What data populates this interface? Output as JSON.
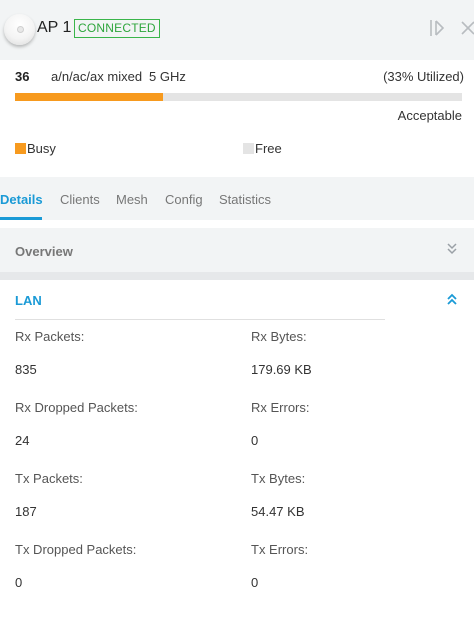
{
  "header": {
    "ap_name": "AP 1",
    "status": "CONNECTED",
    "status_color": "#2ea53c"
  },
  "radio": {
    "channel": "36",
    "mode": "a/n/ac/ax mixed",
    "band": "5 GHz",
    "utilization_text": "(33% Utilized)",
    "utilization_fraction": 0.33,
    "quality": "Acceptable",
    "busy_color": "#f79a1e",
    "free_color": "#e4e4e4"
  },
  "legend": {
    "busy_label": "Busy",
    "free_label": "Free"
  },
  "tabs": [
    {
      "label": "Details",
      "active": true
    },
    {
      "label": "Clients",
      "active": false
    },
    {
      "label": "Mesh",
      "active": false
    },
    {
      "label": "Config",
      "active": false
    },
    {
      "label": "Statistics",
      "active": false
    }
  ],
  "sections": {
    "overview_title": "Overview",
    "lan_title": "LAN"
  },
  "lan": {
    "rx_packets_label": "Rx Packets:",
    "rx_packets": "835",
    "rx_bytes_label": "Rx Bytes:",
    "rx_bytes": "179.69 KB",
    "rx_dropped_label": "Rx Dropped Packets:",
    "rx_dropped": "24",
    "rx_errors_label": "Rx Errors:",
    "rx_errors": "0",
    "tx_packets_label": "Tx Packets:",
    "tx_packets": "187",
    "tx_bytes_label": "Tx Bytes:",
    "tx_bytes": "54.47 KB",
    "tx_dropped_label": "Tx Dropped Packets:",
    "tx_dropped": "0",
    "tx_errors_label": "Tx Errors:",
    "tx_errors": "0"
  },
  "icons": {
    "locate": "locate-icon",
    "close": "close-icon",
    "expand": "chevron-double-down-icon",
    "collapse": "chevron-double-up-icon"
  },
  "accent_color": "#1a9ad6"
}
